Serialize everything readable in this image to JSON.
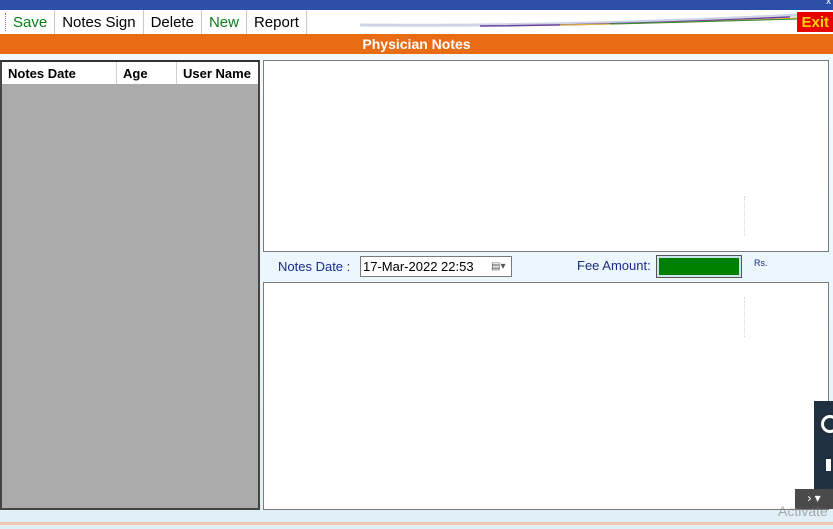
{
  "toolbar": {
    "save": "Save",
    "notes_sign": "Notes Sign",
    "delete": "Delete",
    "new": "New",
    "report": "Report",
    "exit": "Exit",
    "close_glyph": "x"
  },
  "header": {
    "title": "Physician Notes"
  },
  "list": {
    "columns": [
      "Notes Date",
      "Age",
      "User Name"
    ],
    "rows": []
  },
  "form": {
    "notes_date_label": "Notes Date :",
    "notes_date_value": "17-Mar-2022 22:53",
    "fee_amount_label": "Fee Amount:",
    "fee_currency": "Rs."
  },
  "overlay": {
    "activate_text": "Activate",
    "scroll_glyph": "› ▾"
  },
  "colors": {
    "title_bar": "#e96b14",
    "fee_field": "#008000",
    "exit_bg": "#e60000",
    "exit_fg": "#ffd200",
    "label_text": "#1a2a8a"
  }
}
